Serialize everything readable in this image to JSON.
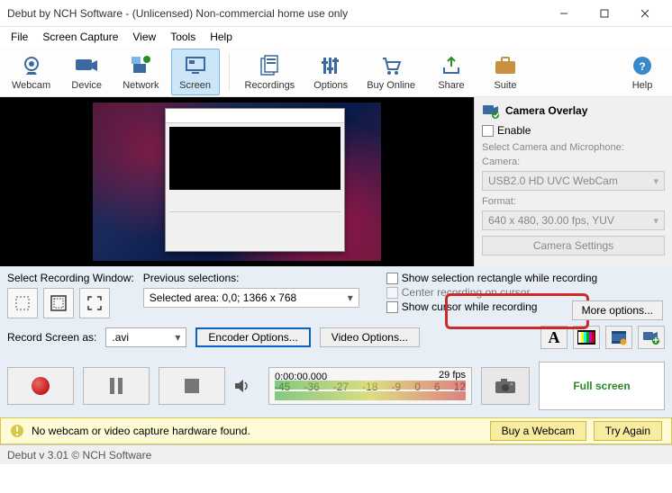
{
  "window": {
    "title": "Debut by NCH Software - (Unlicensed) Non-commercial home use only"
  },
  "menu": {
    "file": "File",
    "screen_capture": "Screen Capture",
    "view": "View",
    "tools": "Tools",
    "help": "Help"
  },
  "toolbar": {
    "webcam": "Webcam",
    "device": "Device",
    "network": "Network",
    "screen": "Screen",
    "recordings": "Recordings",
    "options": "Options",
    "buy_online": "Buy Online",
    "share": "Share",
    "suite": "Suite",
    "help": "Help"
  },
  "overlay": {
    "title": "Camera Overlay",
    "enable": "Enable",
    "select_label": "Select Camera and Microphone:",
    "camera_label": "Camera:",
    "camera_value": "USB2.0 HD UVC WebCam",
    "format_label": "Format:",
    "format_value": "640 x 480, 30.00 fps, YUV",
    "settings_btn": "Camera Settings"
  },
  "selwin": {
    "label": "Select Recording Window:"
  },
  "prevsel": {
    "label": "Previous selections:",
    "value": "Selected area: 0,0; 1366 x 768"
  },
  "checks": {
    "show_selection": "Show selection rectangle while recording",
    "center_cursor": "Center recording on cursor",
    "show_cursor": "Show cursor while recording"
  },
  "more_options": "More options...",
  "encoder": {
    "label": "Record Screen as:",
    "format": ".avi",
    "encoder_opts": "Encoder Options...",
    "video_opts": "Video Options..."
  },
  "controls": {
    "timecode": "0:00:00.000",
    "fps": "29 fps",
    "scale": [
      "-45",
      "-36",
      "-27",
      "-18",
      "-9",
      "0",
      "6",
      "12"
    ],
    "fullscreen": "Full screen"
  },
  "warning": {
    "text": "No webcam or video capture hardware found.",
    "buy": "Buy a Webcam",
    "retry": "Try Again"
  },
  "status": {
    "text": "Debut v 3.01  © NCH Software"
  }
}
